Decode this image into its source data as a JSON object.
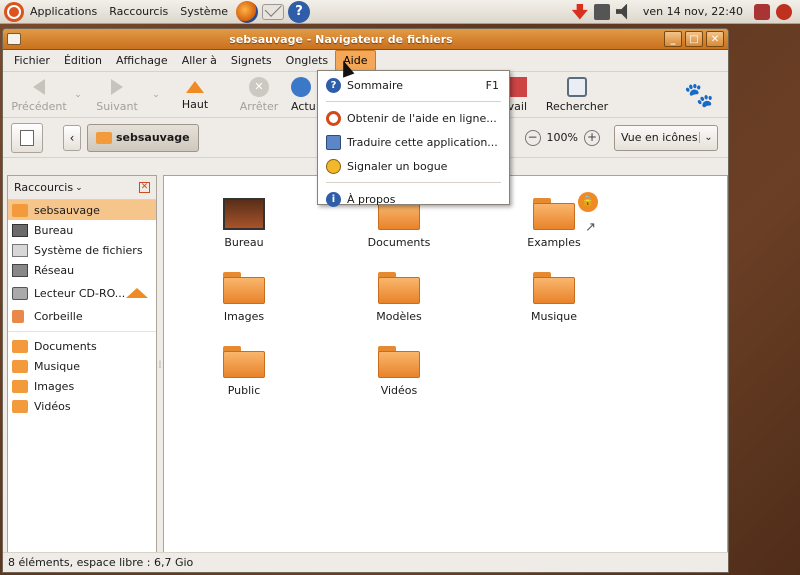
{
  "top_panel": {
    "menus": [
      "Applications",
      "Raccourcis",
      "Système"
    ],
    "clock": "ven 14 nov, 22:40"
  },
  "window": {
    "title": "sebsauvage - Navigateur de fichiers",
    "controls": [
      "_",
      "□",
      "✕"
    ]
  },
  "menubar": [
    "Fichier",
    "Édition",
    "Affichage",
    "Aller à",
    "Signets",
    "Onglets",
    "Aide"
  ],
  "toolbar": {
    "back": "Précédent",
    "forward": "Suivant",
    "up": "Haut",
    "stop": "Arrêter",
    "reload": "Actu",
    "home_partial": "e travail",
    "search": "Rechercher"
  },
  "location": {
    "current": "sebsauvage",
    "zoom": "100%",
    "view_mode": "Vue en icônes"
  },
  "sidebar": {
    "header": "Raccourcis",
    "items": [
      {
        "label": "sebsauvage",
        "icon": "home-folder-icon"
      },
      {
        "label": "Bureau",
        "icon": "desktop-icon"
      },
      {
        "label": "Système de fichiers",
        "icon": "filesystem-icon"
      },
      {
        "label": "Réseau",
        "icon": "network-icon"
      },
      {
        "label": "Lecteur CD-RO...",
        "icon": "cdrom-icon"
      },
      {
        "label": "Corbeille",
        "icon": "trash-icon"
      }
    ],
    "bookmarks": [
      {
        "label": "Documents",
        "icon": "folder-icon"
      },
      {
        "label": "Musique",
        "icon": "folder-icon"
      },
      {
        "label": "Images",
        "icon": "folder-icon"
      },
      {
        "label": "Vidéos",
        "icon": "folder-icon"
      }
    ]
  },
  "files": [
    {
      "label": "Bureau",
      "kind": "desktop"
    },
    {
      "label": "Documents",
      "kind": "folder"
    },
    {
      "label": "Examples",
      "kind": "link"
    },
    {
      "label": "Images",
      "kind": "folder"
    },
    {
      "label": "Modèles",
      "kind": "folder"
    },
    {
      "label": "Musique",
      "kind": "folder"
    },
    {
      "label": "Public",
      "kind": "folder"
    },
    {
      "label": "Vidéos",
      "kind": "folder"
    }
  ],
  "status": "8 éléments, espace libre : 6,7 Gio",
  "help_menu": {
    "items": [
      {
        "label": "Sommaire",
        "shortcut": "F1",
        "icon": "help-icon"
      },
      {
        "label": "Obtenir de l'aide en ligne...",
        "icon": "lifebuoy-icon"
      },
      {
        "label": "Traduire cette application...",
        "icon": "translate-icon"
      },
      {
        "label": "Signaler un bogue",
        "icon": "bug-icon"
      },
      {
        "label": "À propos",
        "icon": "info-icon"
      }
    ]
  }
}
